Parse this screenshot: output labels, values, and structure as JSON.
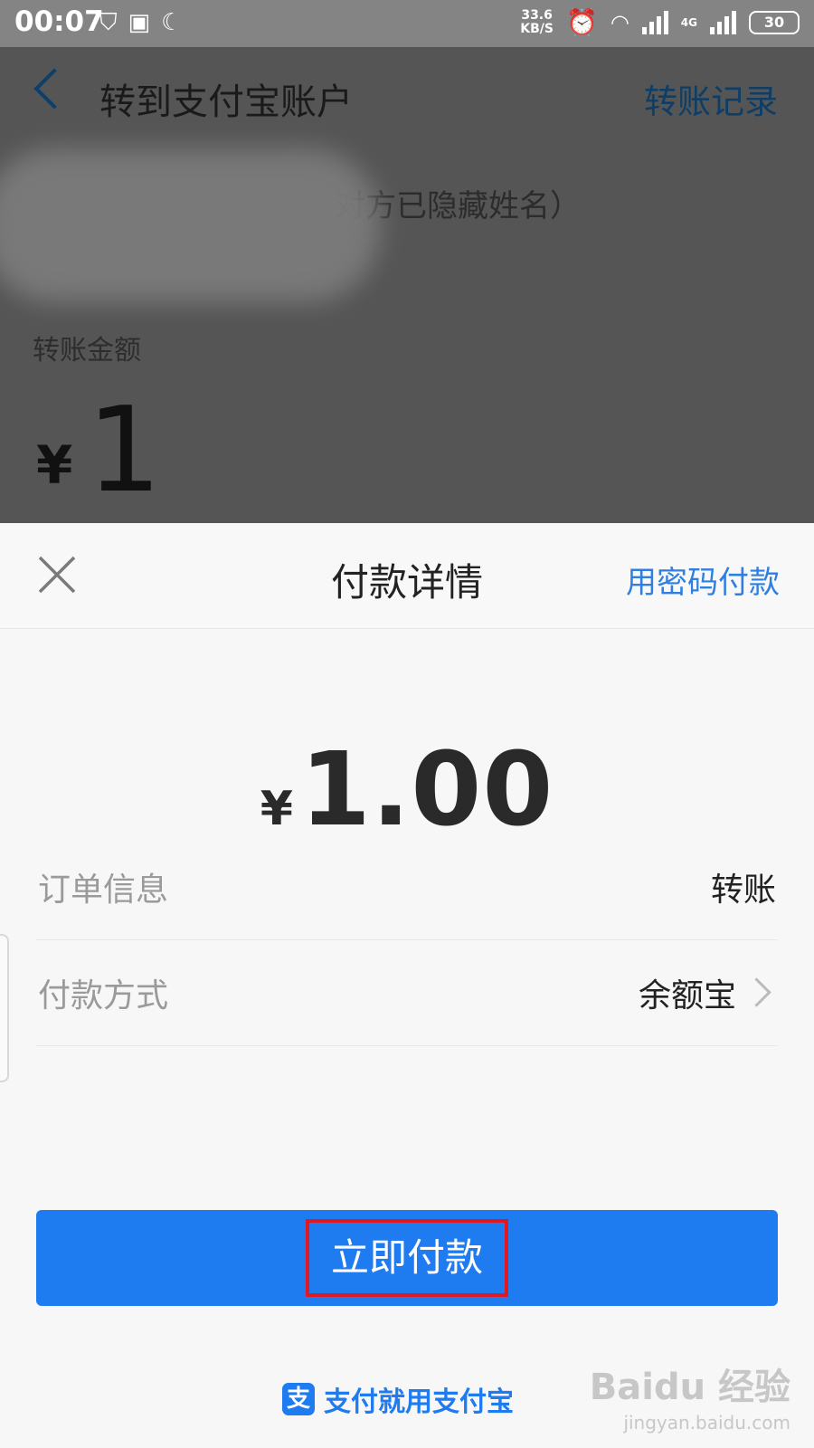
{
  "status_bar": {
    "time": "00:07",
    "left_icons": [
      "shield-yen-icon",
      "image-icon",
      "moon-icon"
    ],
    "net_speed_value": "33.6",
    "net_speed_unit": "KB/S",
    "network_type": "4G",
    "battery": "30"
  },
  "background_page": {
    "title": "转到支付宝账户",
    "history_link": "转账记录",
    "recipient_note": "对方已隐藏姓名）",
    "amount_label": "转账金额",
    "currency": "¥",
    "amount": "1"
  },
  "payment_sheet": {
    "title": "付款详情",
    "password_link": "用密码付款",
    "currency": "¥",
    "amount": "1.00",
    "order_label": "订单信息",
    "order_value": "转账",
    "method_label": "付款方式",
    "method_value": "余额宝",
    "pay_button": "立即付款",
    "highlight_color": "#e01822",
    "accent_color": "#1e7bf0"
  },
  "footer": {
    "brand_logo": "支",
    "brand_text": "支付就用支付宝"
  },
  "watermark": {
    "main": "Baidu 经验",
    "sub": "jingyan.baidu.com"
  }
}
